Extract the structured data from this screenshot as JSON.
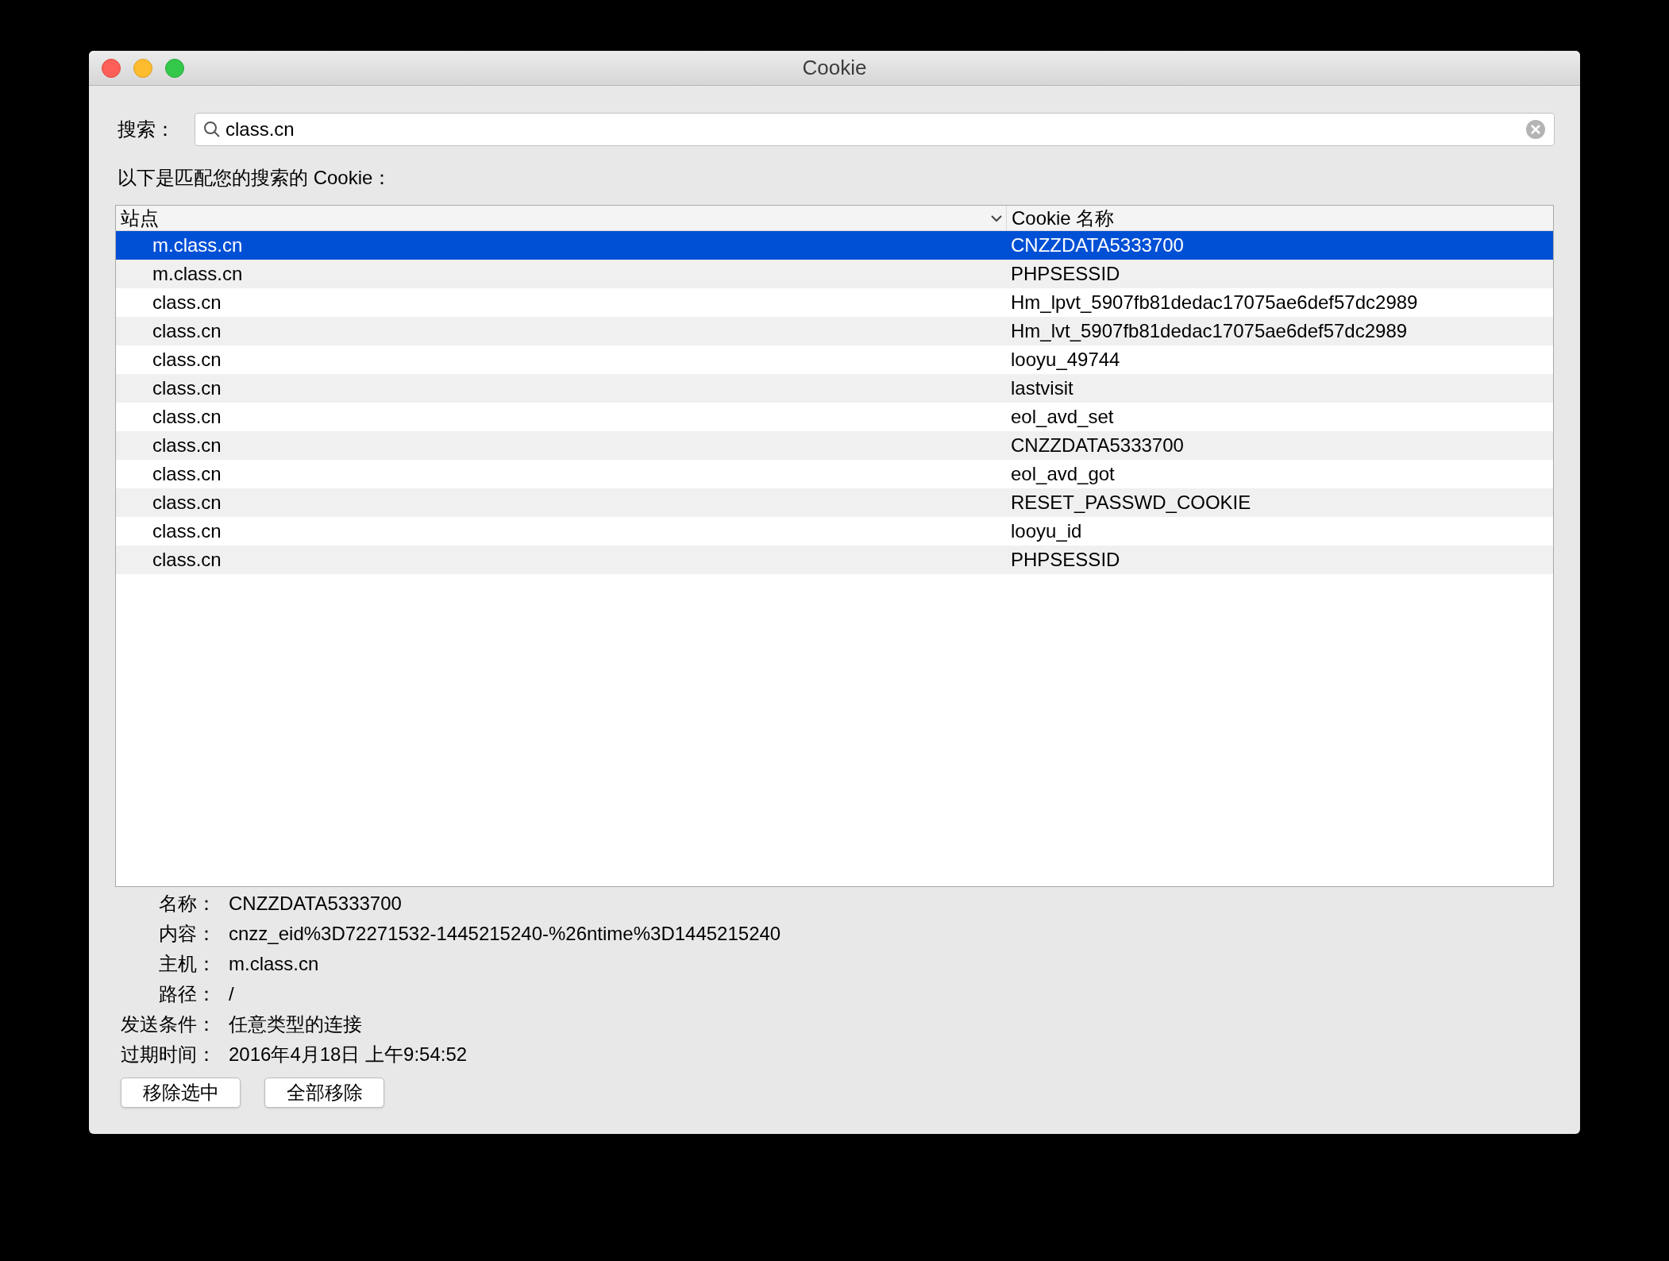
{
  "window": {
    "title": "Cookie"
  },
  "search": {
    "label": "搜索：",
    "value": "class.cn"
  },
  "caption": "以下是匹配您的搜索的 Cookie：",
  "table": {
    "columns": [
      {
        "label": "站点",
        "sorted": true
      },
      {
        "label": "Cookie 名称",
        "sorted": false
      }
    ],
    "rows": [
      {
        "site": "m.class.cn",
        "name": "CNZZDATA5333700",
        "selected": true
      },
      {
        "site": "m.class.cn",
        "name": "PHPSESSID",
        "selected": false
      },
      {
        "site": "class.cn",
        "name": "Hm_lpvt_5907fb81dedac17075ae6def57dc2989",
        "selected": false
      },
      {
        "site": "class.cn",
        "name": "Hm_lvt_5907fb81dedac17075ae6def57dc2989",
        "selected": false
      },
      {
        "site": "class.cn",
        "name": "looyu_49744",
        "selected": false
      },
      {
        "site": "class.cn",
        "name": "lastvisit",
        "selected": false
      },
      {
        "site": "class.cn",
        "name": "eol_avd_set",
        "selected": false
      },
      {
        "site": "class.cn",
        "name": "CNZZDATA5333700",
        "selected": false
      },
      {
        "site": "class.cn",
        "name": "eol_avd_got",
        "selected": false
      },
      {
        "site": "class.cn",
        "name": "RESET_PASSWD_COOKIE",
        "selected": false
      },
      {
        "site": "class.cn",
        "name": "looyu_id",
        "selected": false
      },
      {
        "site": "class.cn",
        "name": "PHPSESSID",
        "selected": false
      }
    ]
  },
  "details": [
    {
      "label": "名称：",
      "value": "CNZZDATA5333700"
    },
    {
      "label": "内容：",
      "value": "cnzz_eid%3D72271532-1445215240-%26ntime%3D1445215240"
    },
    {
      "label": "主机：",
      "value": "m.class.cn"
    },
    {
      "label": "路径：",
      "value": "/"
    },
    {
      "label": "发送条件：",
      "value": "任意类型的连接"
    },
    {
      "label": "过期时间：",
      "value": "2016年4月18日 上午9:54:52"
    }
  ],
  "buttons": [
    "移除选中",
    "全部移除"
  ]
}
